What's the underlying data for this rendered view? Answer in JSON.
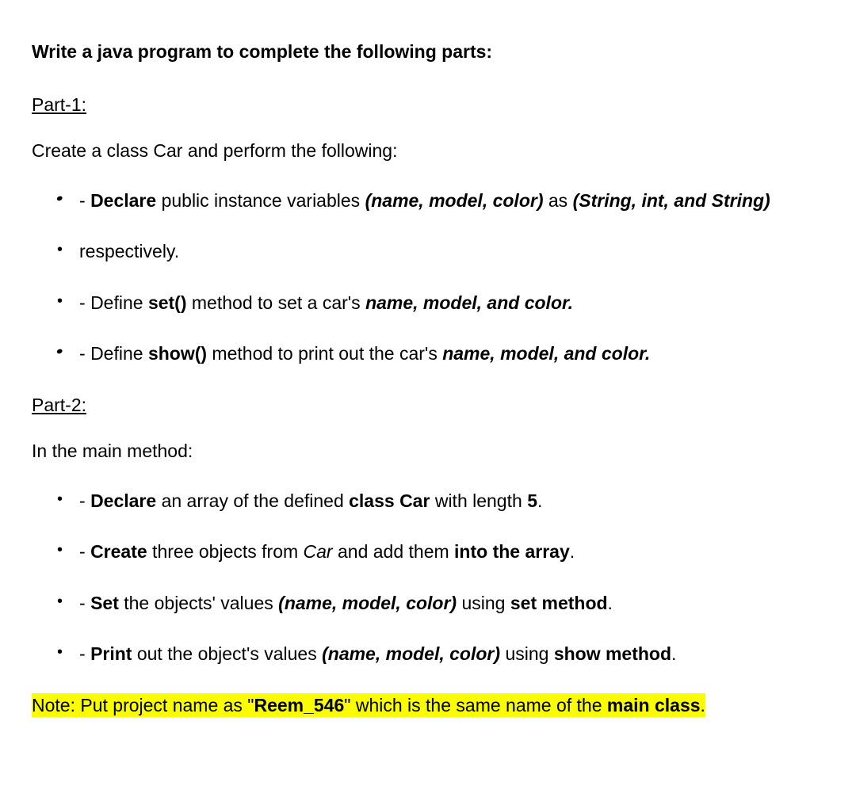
{
  "title": "Write a java program to complete the following parts:",
  "part1": {
    "header": "Part-1: ",
    "intro": "Create a class Car and perform the following:",
    "items": [
      {
        "prefix": "  - ",
        "b1": "Declare",
        "t1": " public instance variables ",
        "bi1": "(name, model, color)",
        "t2": " as ",
        "bi2": "(String, int, and String)"
      },
      {
        "t1": "respectively."
      },
      {
        "prefix": "  - ",
        "t1": "Define ",
        "b1": "set()",
        "t2": " method to set a car's ",
        "bi1": "name, model, and color."
      },
      {
        "prefix": "  - ",
        "t1": "Define ",
        "b1": "show()",
        "t2": " method to print out the car's ",
        "bi1": "name, model, and color."
      }
    ]
  },
  "part2": {
    "header": "Part-2:",
    "intro": "In the main method:",
    "items": [
      {
        "prefix": "  - ",
        "b1": "Declare",
        "t1": " an array of the defined ",
        "b2": "class Car",
        "t2": " with length ",
        "b3": "5",
        "t3": "."
      },
      {
        "prefix": "  - ",
        "b1": "Create",
        "t1": " three objects from ",
        "i1": "Car ",
        "t2": "and add them ",
        "b2": "into the array",
        "t3": "."
      },
      {
        "prefix": "  - ",
        "b1": "Set",
        "t1": " the objects' values ",
        "bi1": "(name, model, color) ",
        "t2": "using ",
        "b2": "set method",
        "t3": "."
      },
      {
        "prefix": "  - ",
        "b1": "Print",
        "t1": " out the object's values ",
        "bi1": "(name, model, color) ",
        "t2": "using ",
        "b2": "show method",
        "t3": "."
      }
    ]
  },
  "note": {
    "t1": "Note: Put project name as \"",
    "b1": "Reem_546",
    "t2": "\" which is the same name of the ",
    "b2": "main class",
    "t3": "."
  }
}
